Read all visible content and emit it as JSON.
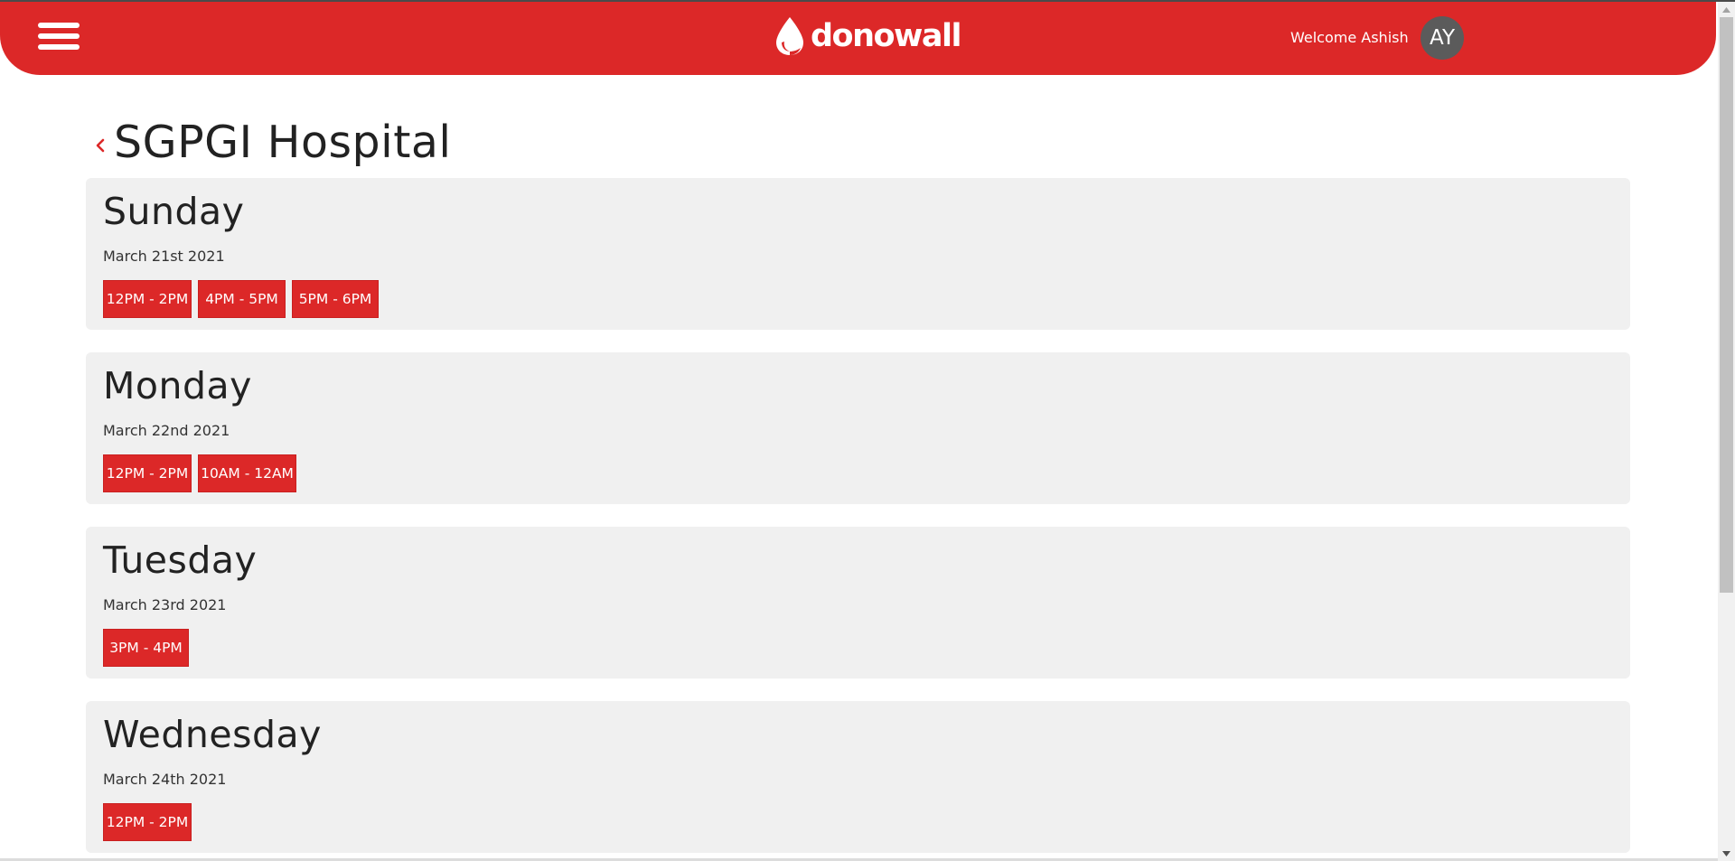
{
  "colors": {
    "brand_red": "#dc2828",
    "card_bg": "#f0f0f0",
    "avatar_bg": "#5b5b5b"
  },
  "header": {
    "brand_name": "donowall",
    "welcome_text": "Welcome Ashish",
    "avatar_initials": "AY",
    "menu_icon": "hamburger-menu-icon",
    "logo_icon": "blood-drop-icon"
  },
  "page": {
    "back_icon": "chevron-left-icon",
    "title": "SGPGI Hospital"
  },
  "days": [
    {
      "name": "Sunday",
      "date": "March 21st 2021",
      "slots": [
        "12PM - 2PM",
        "4PM - 5PM",
        "5PM - 6PM"
      ]
    },
    {
      "name": "Monday",
      "date": "March 22nd 2021",
      "slots": [
        "12PM - 2PM",
        "10AM - 12AM"
      ]
    },
    {
      "name": "Tuesday",
      "date": "March 23rd 2021",
      "slots": [
        "3PM - 4PM"
      ]
    },
    {
      "name": "Wednesday",
      "date": "March 24th 2021",
      "slots": [
        "12PM - 2PM"
      ]
    }
  ]
}
